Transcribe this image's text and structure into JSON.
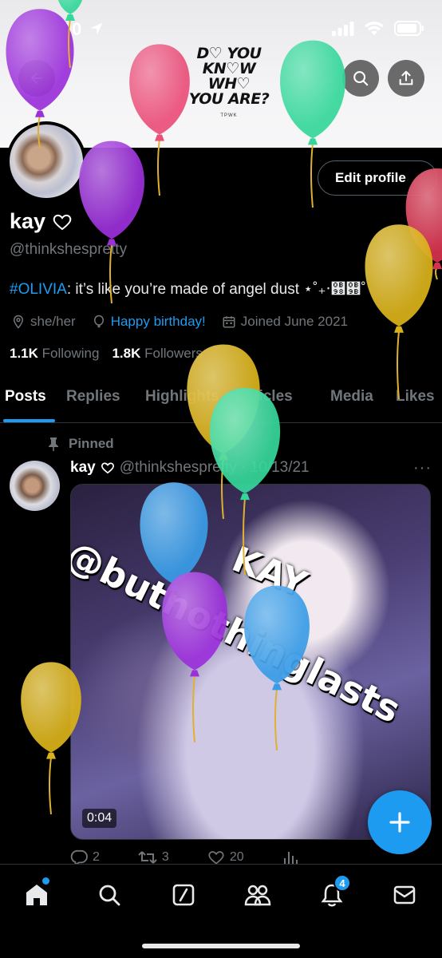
{
  "status": {
    "time": "12:00"
  },
  "banner": {
    "lines": [
      "D♡ YOU",
      "KN♡W",
      "WH♡",
      "YOU ARE?"
    ],
    "sub": "TPWK"
  },
  "profile": {
    "edit_label": "Edit profile",
    "name": "kay",
    "handle": "@thinkshespretty",
    "bio_tag": "#OLIVIA",
    "bio_text": ": it’s like you’re made of angel dust ⋆˚₊‧஘஛˚",
    "pronouns": "she/her",
    "birthday": "Happy birthday!",
    "joined": "Joined June 2021",
    "following_count": "1.1K",
    "following_label": "Following",
    "followers_count": "1.8K",
    "followers_label": "Followers"
  },
  "tabs": [
    "Posts",
    "Replies",
    "Highlights",
    "Articles",
    "Media",
    "Likes"
  ],
  "post": {
    "pinned_label": "Pinned",
    "name": "kay",
    "meta": "@thinkshespretty · 10/13/21",
    "more": "···",
    "video_text_1": "@butnothinglasts",
    "video_text_2": "KAY",
    "duration": "0:04",
    "replies": "2",
    "reposts": "3",
    "likes": "20"
  },
  "nav": {
    "notifications_badge": "4"
  },
  "colors": {
    "accent": "#1d9bf0",
    "balloon_purple": "#9b30d9",
    "balloon_pink": "#ea4f7a",
    "balloon_green": "#35d69a",
    "balloon_yellow": "#d9b21a",
    "balloon_blue": "#3a9ce6",
    "balloon_red": "#d8314e"
  }
}
